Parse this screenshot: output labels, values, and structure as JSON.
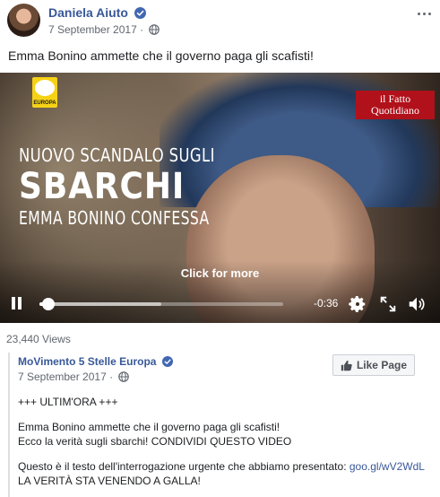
{
  "post": {
    "author": "Daniela Aiuto",
    "date": "7 September 2017",
    "text": "Emma Bonino ammette che il governo paga gli scafisti!"
  },
  "video": {
    "headline_line1": "NUOVO SCANDALO SUGLI",
    "headline_line2": "SBARCHI",
    "headline_line3": "EMMA BONINO CONFESSA",
    "click_for_more": "Click for more",
    "time_remaining": "-0:36",
    "progress": 0.02,
    "buffered": 0.5,
    "logo_left_text": "EUROPA",
    "logo_right_text": "il Fatto Quotidiano"
  },
  "views": "23,440 Views",
  "shared": {
    "page_name": "MoVimento 5 Stelle Europa",
    "date": "7 September 2017",
    "like_page_label": "Like Page",
    "line1": "+++ ULTIM'ORA +++",
    "line2": "Emma Bonino ammette che il governo paga gli scafisti!",
    "line3": "Ecco la verità sugli sbarchi! CONDIVIDI QUESTO VIDEO",
    "line4": "Questo è il testo dell'interrogazione urgente che abbiamo presentato:",
    "link": "goo.gl/wV2WdL",
    "line5": "LA VERITÀ STA VENENDO A GALLA!"
  },
  "colors": {
    "link_blue": "#385898",
    "verified_blue": "#4267b2",
    "secondary_text": "#606770",
    "ifq_red": "#b1111b",
    "m5s_yellow": "#f6d215"
  },
  "icons": [
    "verified-badge-icon",
    "globe-icon",
    "more-options-icon",
    "pause-icon",
    "settings-icon",
    "fullscreen-icon",
    "volume-icon",
    "thumbs-up-icon"
  ]
}
